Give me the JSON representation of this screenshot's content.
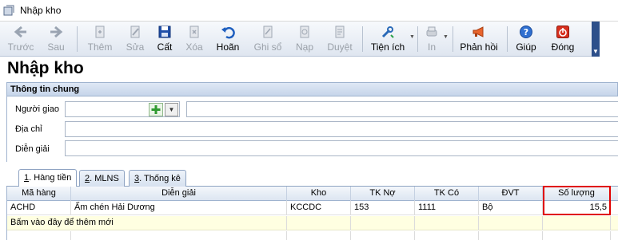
{
  "window": {
    "title": "Nhập kho"
  },
  "toolbar": {
    "back": "Trước",
    "forward": "Sau",
    "add": "Thêm",
    "edit": "Sửa",
    "save": "Cất",
    "delete": "Xóa",
    "undo": "Hoãn",
    "post": "Ghi sổ",
    "load": "Nạp",
    "approve": "Duyệt",
    "utilities": "Tiện ích",
    "print": "In",
    "feedback": "Phản hồi",
    "help": "Giúp",
    "close": "Đóng"
  },
  "page": {
    "title": "Nhập kho"
  },
  "general_info": {
    "header": "Thông tin chung",
    "deliverer_label": "Người giao",
    "address_label": "Địa chỉ",
    "description_label": "Diễn giải",
    "deliverer_code": "",
    "deliverer_name": "",
    "address": "",
    "description": ""
  },
  "tabs": [
    {
      "num": "1",
      "label": ". Hàng tiền"
    },
    {
      "num": "2",
      "label": ". MLNS"
    },
    {
      "num": "3",
      "label": ". Thống kê"
    }
  ],
  "grid": {
    "columns": [
      "Mã hàng",
      "Diễn giải",
      "Kho",
      "TK Nợ",
      "TK Có",
      "ĐVT",
      "Số lượng"
    ],
    "rows": [
      {
        "code": "ACHD",
        "description": "Ấm chén Hải Dương",
        "warehouse": "KCCDC",
        "debit": "153",
        "credit": "1111",
        "unit": "Bộ",
        "quantity": "15,5"
      }
    ],
    "new_row_hint": "Bấm vào đây để thêm mới"
  },
  "colors": {
    "toolbar_grip": "#2c4f8a",
    "highlight": "#e00000",
    "new_row_bg": "#ffffe1"
  },
  "icons": [
    "app-icon",
    "arrow-left-icon",
    "arrow-right-icon",
    "add-doc-icon",
    "edit-doc-icon",
    "floppy-save-icon",
    "delete-doc-icon",
    "undo-icon",
    "post-ledger-icon",
    "load-icon",
    "approve-icon",
    "tools-icon",
    "print-icon",
    "megaphone-icon",
    "help-icon",
    "power-icon",
    "plus-icon",
    "chevron-down-icon"
  ]
}
